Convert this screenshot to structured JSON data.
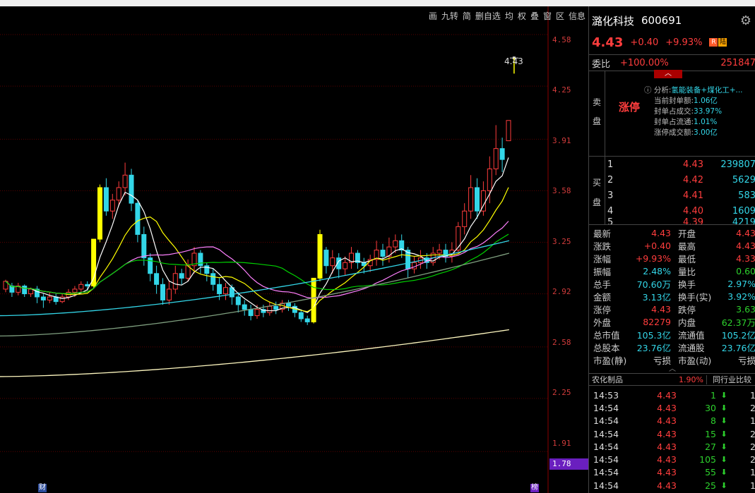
{
  "toolbar": {
    "items": [
      "画",
      "九转",
      "简",
      "删自选",
      "均",
      "权",
      "叠",
      "窗",
      "区",
      "信息"
    ]
  },
  "price_axis": {
    "ticks": [
      "4.58",
      "4.25",
      "3.91",
      "3.58",
      "3.25",
      "2.92",
      "2.58",
      "2.25",
      "1.91"
    ],
    "current": "1.78",
    "last_label": "4.43"
  },
  "bottom_markers": {
    "left": "财",
    "right": "榜"
  },
  "colors": {
    "up": "#ff3d3d",
    "down": "#33d6e8",
    "limit_up_candle": "#ffff00",
    "grid": "#5a0000"
  },
  "chart_data": {
    "type": "candlestick",
    "title": "",
    "ylim": [
      1.78,
      4.58
    ],
    "candles": [
      [
        2.95,
        3.0,
        2.93,
        3.01
      ],
      [
        2.97,
        2.93,
        2.9,
        2.99
      ],
      [
        2.93,
        2.97,
        2.91,
        2.99
      ],
      [
        2.97,
        2.92,
        2.9,
        2.98
      ],
      [
        2.92,
        2.95,
        2.9,
        2.96
      ],
      [
        2.95,
        2.9,
        2.86,
        2.97
      ],
      [
        2.9,
        2.88,
        2.83,
        2.92
      ],
      [
        2.88,
        2.9,
        2.86,
        2.93
      ],
      [
        2.9,
        2.87,
        2.85,
        2.92
      ],
      [
        2.87,
        2.9,
        2.86,
        2.92
      ],
      [
        2.9,
        2.93,
        2.88,
        2.95
      ],
      [
        2.93,
        2.95,
        2.9,
        2.97
      ],
      [
        2.95,
        2.98,
        2.93,
        3.0
      ],
      [
        2.98,
        2.97,
        2.94,
        3.0
      ],
      [
        2.97,
        3.27,
        2.96,
        3.27
      ],
      [
        3.27,
        3.6,
        3.25,
        3.62
      ],
      [
        3.6,
        3.45,
        3.42,
        3.66
      ],
      [
        3.45,
        3.52,
        3.4,
        3.56
      ],
      [
        3.52,
        3.6,
        3.48,
        3.64
      ],
      [
        3.6,
        3.68,
        3.55,
        3.76
      ],
      [
        3.68,
        3.5,
        3.45,
        3.72
      ],
      [
        3.5,
        3.3,
        3.25,
        3.52
      ],
      [
        3.3,
        3.15,
        3.1,
        3.35
      ],
      [
        3.15,
        3.05,
        3.0,
        3.18
      ],
      [
        3.05,
        2.98,
        2.92,
        3.1
      ],
      [
        2.98,
        2.88,
        2.85,
        3.02
      ],
      [
        2.88,
        2.95,
        2.85,
        3.0
      ],
      [
        2.95,
        3.05,
        2.92,
        3.1
      ],
      [
        3.05,
        3.02,
        2.98,
        3.08
      ],
      [
        3.02,
        3.1,
        3.0,
        3.14
      ],
      [
        3.1,
        3.18,
        3.05,
        3.22
      ],
      [
        3.18,
        3.1,
        3.05,
        3.2
      ],
      [
        3.1,
        3.05,
        3.0,
        3.12
      ],
      [
        3.05,
        2.98,
        2.94,
        3.08
      ],
      [
        2.98,
        2.92,
        2.88,
        3.02
      ],
      [
        2.92,
        2.96,
        2.88,
        2.99
      ],
      [
        2.96,
        2.9,
        2.85,
        2.98
      ],
      [
        2.9,
        2.85,
        2.8,
        2.93
      ],
      [
        2.85,
        2.82,
        2.78,
        2.88
      ],
      [
        2.82,
        2.78,
        2.75,
        2.85
      ],
      [
        2.78,
        2.82,
        2.76,
        2.85
      ],
      [
        2.82,
        2.8,
        2.77,
        2.85
      ],
      [
        2.8,
        2.84,
        2.78,
        2.87
      ],
      [
        2.84,
        2.82,
        2.79,
        2.87
      ],
      [
        2.82,
        2.86,
        2.8,
        2.88
      ],
      [
        2.86,
        2.84,
        2.81,
        2.88
      ],
      [
        2.84,
        2.8,
        2.77,
        2.86
      ],
      [
        2.8,
        2.76,
        2.74,
        2.82
      ],
      [
        2.76,
        2.74,
        2.72,
        2.78
      ],
      [
        2.74,
        3.02,
        2.73,
        3.02
      ],
      [
        3.02,
        3.3,
        3.0,
        3.33
      ],
      [
        3.2,
        3.1,
        3.05,
        3.22
      ],
      [
        3.1,
        3.15,
        3.05,
        3.2
      ],
      [
        3.15,
        3.08,
        3.02,
        3.18
      ],
      [
        3.08,
        3.12,
        3.04,
        3.16
      ],
      [
        3.12,
        3.18,
        3.08,
        3.22
      ],
      [
        3.18,
        3.12,
        3.08,
        3.2
      ],
      [
        3.12,
        3.1,
        3.05,
        3.15
      ],
      [
        3.1,
        3.14,
        3.06,
        3.17
      ],
      [
        3.14,
        3.2,
        3.1,
        3.26
      ],
      [
        3.2,
        3.16,
        3.1,
        3.24
      ],
      [
        3.16,
        3.22,
        3.12,
        3.28
      ],
      [
        3.22,
        3.26,
        3.18,
        3.3
      ],
      [
        3.26,
        3.2,
        3.15,
        3.3
      ],
      [
        3.2,
        3.08,
        3.02,
        3.22
      ],
      [
        3.08,
        3.12,
        3.05,
        3.16
      ],
      [
        3.12,
        3.15,
        3.08,
        3.2
      ],
      [
        3.15,
        3.12,
        3.08,
        3.18
      ],
      [
        3.12,
        3.18,
        3.1,
        3.22
      ],
      [
        3.18,
        3.2,
        3.14,
        3.24
      ],
      [
        3.2,
        3.16,
        3.12,
        3.24
      ],
      [
        3.16,
        3.2,
        3.12,
        3.25
      ],
      [
        3.2,
        3.35,
        3.18,
        3.38
      ],
      [
        3.35,
        3.45,
        3.3,
        3.5
      ],
      [
        3.45,
        3.6,
        3.4,
        3.68
      ],
      [
        3.6,
        3.45,
        3.4,
        3.66
      ],
      [
        3.45,
        3.58,
        3.42,
        3.64
      ],
      [
        3.58,
        3.72,
        3.5,
        3.8
      ],
      [
        3.72,
        3.85,
        3.68,
        4.0
      ],
      [
        3.85,
        3.78,
        3.7,
        3.92
      ],
      [
        3.9,
        4.03,
        3.9,
        4.03
      ]
    ],
    "ma": [
      {
        "name": "MA5",
        "color": "#ffffff"
      },
      {
        "name": "MA10",
        "color": "#ffff00"
      },
      {
        "name": "MA20",
        "color": "#ff80ff"
      },
      {
        "name": "MA30",
        "color": "#00d000"
      },
      {
        "name": "MA60",
        "color": "#33d6e8"
      },
      {
        "name": "MA120",
        "color": "#7f9f7f"
      },
      {
        "name": "MA250",
        "color": "#fff8c0"
      }
    ]
  },
  "panel": {
    "stock_name": "潞化科技",
    "stock_code": "600691",
    "price": "4.43",
    "change": "+0.40",
    "change_pct": "+9.93%",
    "badge_r": "R",
    "badge_lu": "陆",
    "weibi_label": "委比",
    "weibi_value": "+100.00%",
    "weibi_right": "251847",
    "sell_label_1": "卖",
    "sell_label_2": "盘",
    "buy_label_1": "买",
    "buy_label_2": "盘",
    "uplimit": "涨停",
    "analysis": {
      "title": "分析:",
      "title_value": "氢能装备+煤化工+...",
      "rows": [
        {
          "k": "当前封单额:",
          "v": "1.06亿"
        },
        {
          "k": "封单占成交:",
          "v": "33.97%"
        },
        {
          "k": "封单占流通:",
          "v": "1.01%"
        },
        {
          "k": "涨停成交额:",
          "v": "3.00亿"
        }
      ]
    },
    "buy_rows": [
      {
        "n": "1",
        "p": "4.43",
        "q": "239807"
      },
      {
        "n": "2",
        "p": "4.42",
        "q": "5629"
      },
      {
        "n": "3",
        "p": "4.41",
        "q": "583"
      },
      {
        "n": "4",
        "p": "4.40",
        "q": "1609"
      },
      {
        "n": "5",
        "p": "4.39",
        "q": "4219"
      }
    ],
    "stats": [
      {
        "k": "最新",
        "v": "4.43",
        "vc": "red",
        "k2": "开盘",
        "v2": "4.43",
        "v2c": "red"
      },
      {
        "k": "涨跌",
        "v": "+0.40",
        "vc": "red",
        "k2": "最高",
        "v2": "4.43",
        "v2c": "red"
      },
      {
        "k": "涨幅",
        "v": "+9.93%",
        "vc": "red",
        "k2": "最低",
        "v2": "4.33",
        "v2c": "red"
      },
      {
        "k": "振幅",
        "v": "2.48%",
        "vc": "cyan",
        "k2": "量比",
        "v2": "0.60",
        "v2c": "green"
      },
      {
        "k": "总手",
        "v": "70.60万",
        "vc": "cyan",
        "k2": "换手",
        "v2": "2.97%",
        "v2c": "cyan"
      },
      {
        "k": "金额",
        "v": "3.13亿",
        "vc": "cyan",
        "k2": "换手(实)",
        "v2": "3.92%",
        "v2c": "cyan"
      },
      {
        "k": "涨停",
        "v": "4.43",
        "vc": "red",
        "k2": "跌停",
        "v2": "3.63",
        "v2c": "green"
      },
      {
        "k": "外盘",
        "v": "82279",
        "vc": "red",
        "k2": "内盘",
        "v2": "62.37万",
        "v2c": "green"
      },
      {
        "k": "总市值",
        "v": "105.3亿",
        "vc": "cyan",
        "k2": "流通值",
        "v2": "105.2亿",
        "v2c": "cyan"
      },
      {
        "k": "总股本",
        "v": "23.76亿",
        "vc": "cyan",
        "k2": "流通股",
        "v2": "23.76亿",
        "v2c": "cyan"
      },
      {
        "k": "市盈(静)",
        "v": "亏损",
        "vc": "white",
        "k2": "市盈(动)",
        "v2": "亏损",
        "v2c": "white"
      }
    ],
    "industry_name": "农化制品",
    "industry_pct": "1.90%",
    "industry_compare": "同行业比较",
    "trades": [
      {
        "t": "14:53",
        "p": "4.43",
        "q": "1",
        "x": "1"
      },
      {
        "t": "14:54",
        "p": "4.43",
        "q": "30",
        "x": "2"
      },
      {
        "t": "14:54",
        "p": "4.43",
        "q": "8",
        "x": "1"
      },
      {
        "t": "14:54",
        "p": "4.43",
        "q": "15",
        "x": "2"
      },
      {
        "t": "14:54",
        "p": "4.43",
        "q": "27",
        "x": "2"
      },
      {
        "t": "14:54",
        "p": "4.43",
        "q": "105",
        "x": "2"
      },
      {
        "t": "14:54",
        "p": "4.43",
        "q": "55",
        "x": "1"
      },
      {
        "t": "14:54",
        "p": "4.43",
        "q": "25",
        "x": "1"
      }
    ]
  }
}
